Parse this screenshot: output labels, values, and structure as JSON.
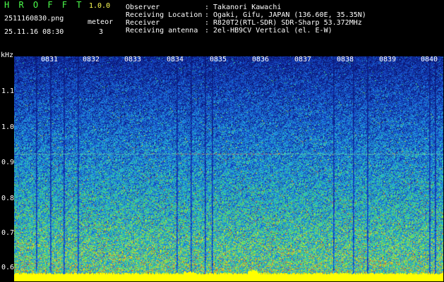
{
  "header": {
    "app_title": "H R O F F T",
    "app_version": "1.0.0",
    "file_name": "2511160830.png",
    "datetime": "25.11.16 08:30",
    "meteor_label": "meteor",
    "meteor_count": "3"
  },
  "info": [
    {
      "label": "Observer",
      "value": ": Takanori Kawachi"
    },
    {
      "label": "Receiving Location",
      "value": ": Ogaki, Gifu, JAPAN (136.60E, 35.35N)"
    },
    {
      "label": "Receiver",
      "value": ": R820T2(RTL-SDR) SDR-Sharp 53.372MHz"
    },
    {
      "label": "Receiving antenna",
      "value": ": 2el-HB9CV Vertical (el. E-W)"
    }
  ],
  "y_axis": {
    "unit": "kHz",
    "ticks": [
      "1.1",
      "1.0",
      "0.9",
      "0.8",
      "0.7",
      "0.6"
    ]
  },
  "x_axis": {
    "ticks": [
      "0831",
      "0832",
      "0833",
      "0834",
      "0835",
      "0836",
      "0837",
      "0838",
      "0839",
      "0840"
    ]
  },
  "colors": {
    "label_text": "#4cff4c",
    "version_text": "#ffff55",
    "spectrum_background": "#1a2f9a",
    "noise_floor": "#ffff00",
    "marker_line": "#4cc8ff"
  }
}
